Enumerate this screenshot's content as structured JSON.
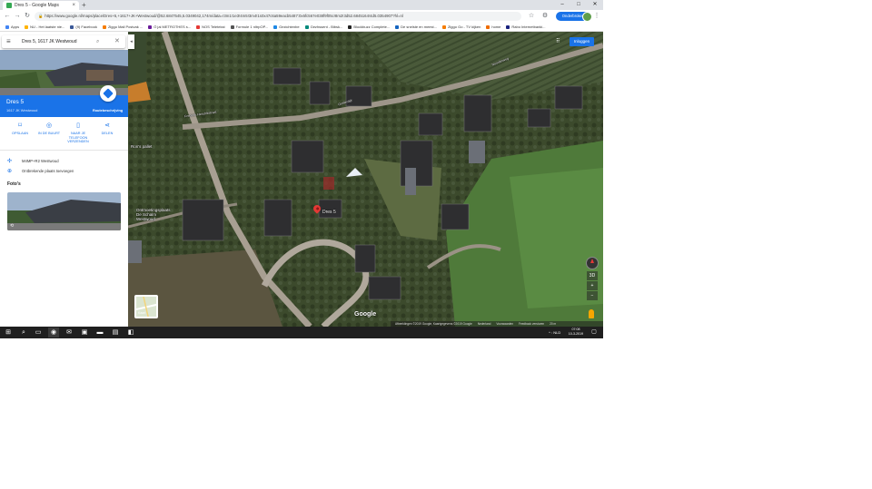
{
  "browser": {
    "tab_title": "Dres 5 - Google Maps",
    "tab_close": "×",
    "new_tab": "+",
    "url": "https://www.google.nl/maps/place/Dres+5,+1617+JK+Westwoud/@52.6847545,5.0349042,174m/data=!3m1!1e3!4m5!3m4!1s0x47c6a59eacb5487:0x6fc567e038f9f05c!8m2!3d52.6845164!4d5.0354907?hl=nl",
    "interrupted_label": "Onderbroken",
    "window_controls": {
      "minimize": "–",
      "maximize": "□",
      "close": "✕"
    },
    "bookmarks": [
      {
        "label": "Apps",
        "color": "#4285f4"
      },
      {
        "label": "NU - Het laatste nie...",
        "color": "#ffb300"
      },
      {
        "label": "(9) Facebook",
        "color": "#3b5998"
      },
      {
        "label": "Ziggo Mail Postvak ...",
        "color": "#f57c00"
      },
      {
        "label": "Ö jal METROTHES s...",
        "color": "#6a1b9a"
      },
      {
        "label": "NOS Teletekst",
        "color": "#e53935"
      },
      {
        "label": "Formule 1 nltrpOP...",
        "color": "#555555"
      },
      {
        "label": "Gezichtenbe",
        "color": "#1e88e5"
      },
      {
        "label": "Gezhssent - Bibsk...",
        "color": "#00897b"
      },
      {
        "label": "Blockbuzz Complete...",
        "color": "#222222"
      },
      {
        "label": "De snelste en meest...",
        "color": "#1565c0"
      },
      {
        "label": "Ziggo Go - TV kijken",
        "color": "#f57c00"
      },
      {
        "label": "home",
        "color": "#ef6c00"
      },
      {
        "label": "Rabo Internetbanki...",
        "color": "#1a237e"
      }
    ]
  },
  "panel": {
    "search_value": "Dres 5, 1617 JK Westwoud",
    "place_title": "Dres 5",
    "place_subtitle": "1617 JK Westwoud",
    "route_label": "Routebeschrijving",
    "actions": [
      {
        "label": "OPSLAAN",
        "icon": "bookmark-icon",
        "glyph": "⌑"
      },
      {
        "label": "IN DE BUURT",
        "icon": "nearby-icon",
        "glyph": "◎"
      },
      {
        "label": "NAAR JE TELEFOON VERZENDEN",
        "icon": "phone-icon",
        "glyph": "▯"
      },
      {
        "label": "DELEN",
        "icon": "share-icon",
        "glyph": "⋖"
      }
    ],
    "plus_code": "M4MP+R2 Westwoud",
    "missing_place": "Ontbrekende plaats toevoegen",
    "photos_heading": "Foto's"
  },
  "map": {
    "pin_label": "Dres 5",
    "labels": [
      {
        "text": "Ron's pallet",
        "name": "label-rons-pallet"
      },
      {
        "text": "Ontmoetingsplaats De Schalm Westwoud",
        "name": "label-de-schalm"
      }
    ],
    "roads": [
      "Frederik Hendrikstraat",
      "Oosterdijk",
      "Noorderweg"
    ],
    "sign_in": "Inloggen",
    "zoom_in": "+",
    "zoom_out": "−",
    "three_d": "3D",
    "layers_label": "Kaart",
    "google": "Google",
    "footer": [
      "Afbeeldingen ©2019 Google, Kaartgegevens ©2019 Google",
      "Nederland",
      "Voorwaarden",
      "Feedback versturen",
      "20 m"
    ]
  },
  "taskbar": {
    "tray": "^ ꞉ NLD",
    "time": "07:08",
    "date": "10-3-2019"
  }
}
